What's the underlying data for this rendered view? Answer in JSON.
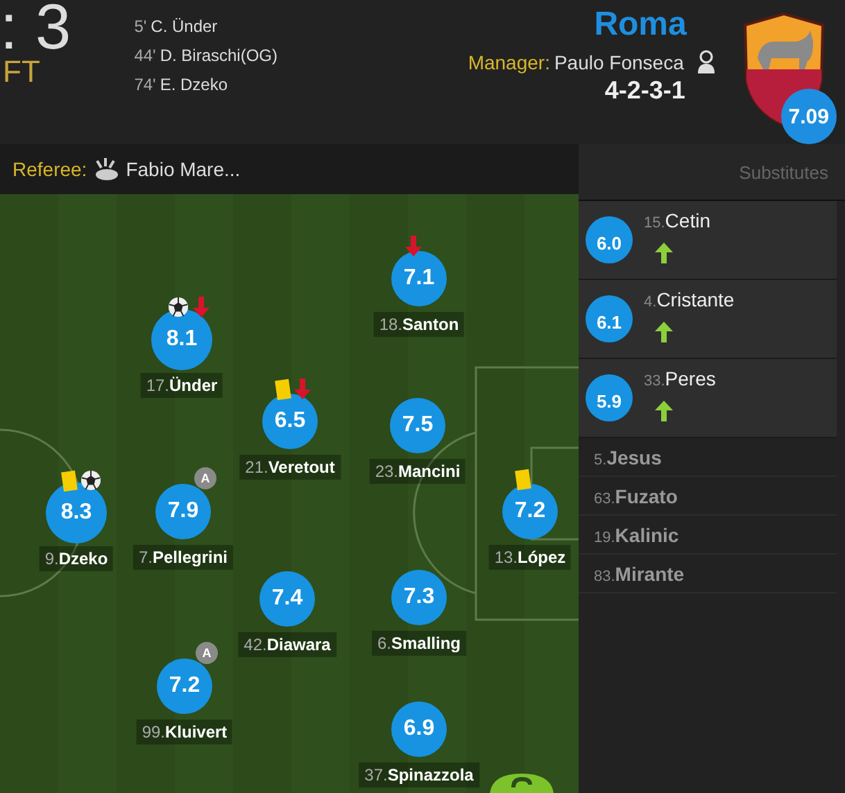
{
  "score": {
    "value": ": 3",
    "status": "FT"
  },
  "goals": [
    {
      "minute": "5'",
      "player": "C. Ünder"
    },
    {
      "minute": "44'",
      "player": "D. Biraschi(OG)"
    },
    {
      "minute": "74'",
      "player": "E. Dzeko"
    }
  ],
  "team": {
    "name": "Roma",
    "manager_label": "Manager:",
    "manager": "Paulo Fonseca",
    "formation": "4-2-3-1",
    "rating": "7.09"
  },
  "referee": {
    "label": "Referee:",
    "name": "Fabio Mare..."
  },
  "substitutes_title": "Substitutes",
  "players": [
    {
      "number": "18.",
      "name": "Santon",
      "rating": "7.1",
      "yellow_card": false,
      "goal": false,
      "subbed_off": true
    },
    {
      "number": "17.",
      "name": "Ünder",
      "rating": "8.1",
      "yellow_card": false,
      "goal": true,
      "subbed_off": true
    },
    {
      "number": "21.",
      "name": "Veretout",
      "rating": "6.5",
      "yellow_card": true,
      "goal": false,
      "subbed_off": true
    },
    {
      "number": "23.",
      "name": "Mancini",
      "rating": "7.5",
      "yellow_card": false,
      "goal": false,
      "subbed_off": false
    },
    {
      "number": "9.",
      "name": "Dzeko",
      "rating": "8.3",
      "yellow_card": true,
      "goal": true,
      "subbed_off": false
    },
    {
      "number": "7.",
      "name": "Pellegrini",
      "rating": "7.9",
      "badge": "A",
      "yellow_card": false,
      "goal": false,
      "subbed_off": false
    },
    {
      "number": "13.",
      "name": "López",
      "rating": "7.2",
      "yellow_card": true,
      "goal": false,
      "subbed_off": false
    },
    {
      "number": "42.",
      "name": "Diawara",
      "rating": "7.4",
      "yellow_card": false,
      "goal": false,
      "subbed_off": false
    },
    {
      "number": "6.",
      "name": "Smalling",
      "rating": "7.3",
      "yellow_card": false,
      "goal": false,
      "subbed_off": false
    },
    {
      "number": "99.",
      "name": "Kluivert",
      "rating": "7.2",
      "badge": "A",
      "yellow_card": false,
      "goal": false,
      "subbed_off": false
    },
    {
      "number": "37.",
      "name": "Spinazzola",
      "rating": "6.9",
      "yellow_card": false,
      "goal": false,
      "subbed_off": false
    }
  ],
  "substitutes": [
    {
      "number": "15.",
      "name": "Cetin",
      "rating": "6.0",
      "subbed_on": true
    },
    {
      "number": "4.",
      "name": "Cristante",
      "rating": "6.1",
      "subbed_on": true
    },
    {
      "number": "33.",
      "name": "Peres",
      "rating": "5.9",
      "subbed_on": true
    },
    {
      "number": "5.",
      "name": "Jesus",
      "subbed_on": false
    },
    {
      "number": "63.",
      "name": "Fuzato",
      "subbed_on": false
    },
    {
      "number": "19.",
      "name": "Kalinic",
      "subbed_on": false
    },
    {
      "number": "83.",
      "name": "Mirante",
      "subbed_on": false
    }
  ]
}
